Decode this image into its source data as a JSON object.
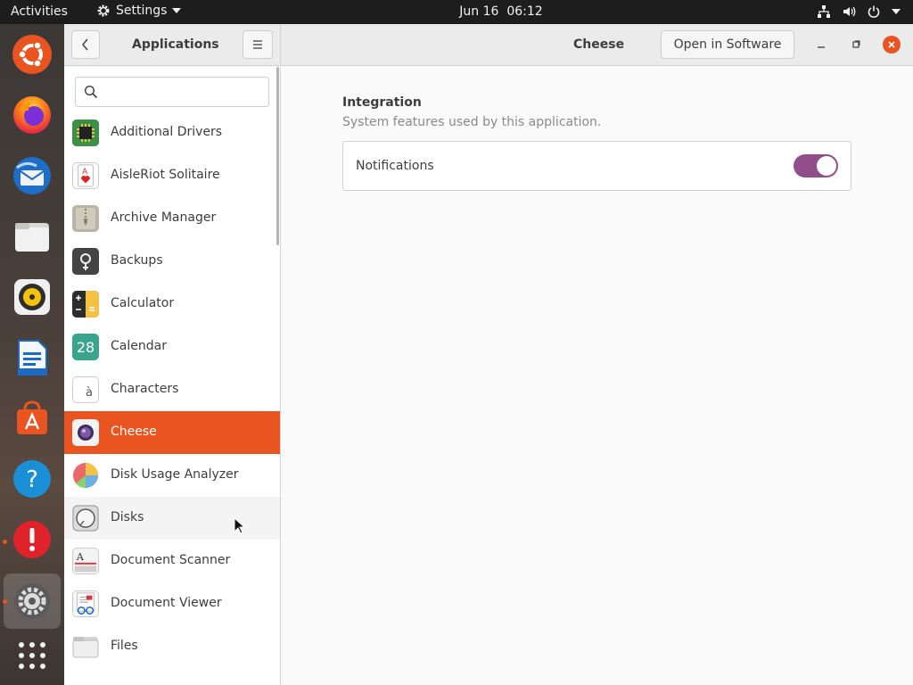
{
  "topbar": {
    "activities": "Activities",
    "settings_menu": "Settings",
    "date": "Jun 16",
    "time": "06:12"
  },
  "dock": {
    "items": [
      "ubuntu-logo-icon",
      "firefox-icon",
      "thunderbird-icon",
      "files-icon",
      "rhythmbox-icon",
      "writer-icon",
      "software-icon",
      "help-icon",
      "updater-icon",
      "settings-icon",
      "app-grid-icon"
    ]
  },
  "sidebar": {
    "title": "Applications",
    "search_placeholder": "",
    "apps": [
      {
        "label": "Additional Drivers"
      },
      {
        "label": "AisleRiot Solitaire"
      },
      {
        "label": "Archive Manager"
      },
      {
        "label": "Backups"
      },
      {
        "label": "Calculator"
      },
      {
        "label": "Calendar",
        "badge": "28"
      },
      {
        "label": "Characters",
        "badge": "à"
      },
      {
        "label": "Cheese"
      },
      {
        "label": "Disk Usage Analyzer"
      },
      {
        "label": "Disks"
      },
      {
        "label": "Document Scanner"
      },
      {
        "label": "Document Viewer"
      },
      {
        "label": "Files"
      }
    ],
    "selected": "Cheese"
  },
  "header": {
    "title": "Cheese",
    "open_software": "Open in Software"
  },
  "content": {
    "section_title": "Integration",
    "section_subtitle": "System features used by this application.",
    "notifications_label": "Notifications",
    "notifications_on": true
  },
  "colors": {
    "accent": "#e95420",
    "toggle": "#924d8b"
  }
}
